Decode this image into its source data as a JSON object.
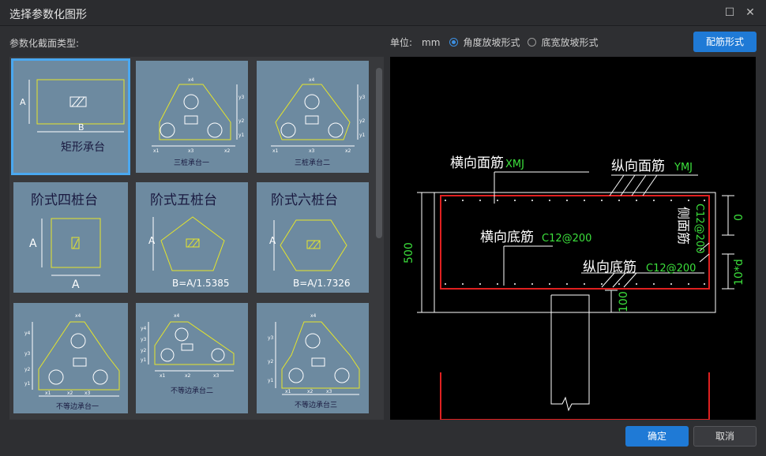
{
  "window": {
    "title": "选择参数化图形"
  },
  "section_label": "参数化截面类型:",
  "units": {
    "label": "单位:",
    "value": "mm",
    "option1": "角度放坡形式",
    "option2": "底宽放坡形式",
    "selected": "option1"
  },
  "buttons": {
    "rebar": "配筋形式",
    "ok": "确定",
    "cancel": "取消"
  },
  "thumbs": {
    "t1": {
      "caption": "矩形承台",
      "dim_a": "A",
      "dim_b": "B"
    },
    "t2": {
      "caption": "三桩承台一",
      "x1": "x1",
      "x2": "x2",
      "x3": "x3",
      "x4": "x4",
      "y1": "y1",
      "y2": "y2",
      "y3": "y3"
    },
    "t3": {
      "caption": "三桩承台二",
      "x1": "x1",
      "x2": "x2",
      "x3": "x3",
      "x4": "x4",
      "y1": "y1",
      "y2": "y2",
      "y3": "y3"
    },
    "t4": {
      "caption": "阶式四桩台",
      "dim_a1": "A",
      "dim_a2": "A"
    },
    "t5": {
      "caption": "阶式五桩台",
      "dim_a": "A",
      "formula": "B=A/1.5385"
    },
    "t6": {
      "caption": "阶式六桩台",
      "dim_a": "A",
      "formula": "B=A/1.7326"
    },
    "t7": {
      "caption": "不等边承台一",
      "x1": "x1",
      "x2": "x2",
      "x3": "x3",
      "x4": "x4",
      "y1": "y1",
      "y2": "y2",
      "y3": "y3",
      "y4": "y4"
    },
    "t8": {
      "caption": "不等边承台二",
      "x1": "x1",
      "x2": "x2",
      "x3": "x3",
      "x4": "x4",
      "y1": "y1",
      "y2": "y2",
      "y3": "y3",
      "y4": "y4"
    },
    "t9": {
      "caption": "不等边承台三",
      "x1": "x1",
      "x2": "x2",
      "x3": "x3",
      "x4": "x4",
      "y1": "y1",
      "y2": "y2",
      "y3": "y3"
    }
  },
  "preview": {
    "top_trans_label": "横向面筋",
    "top_trans_code": "XMJ",
    "top_long_label": "纵向面筋",
    "top_long_code": "YMJ",
    "bot_trans_label": "横向底筋",
    "bot_trans_value": "C12@200",
    "bot_long_label": "纵向底筋",
    "bot_long_value": "C12@200",
    "side_label": "侧面筋",
    "side_value": "C12@200",
    "dim_height": "500",
    "dim_top": "0",
    "dim_side": "10*d",
    "dim_bottom": "100"
  }
}
